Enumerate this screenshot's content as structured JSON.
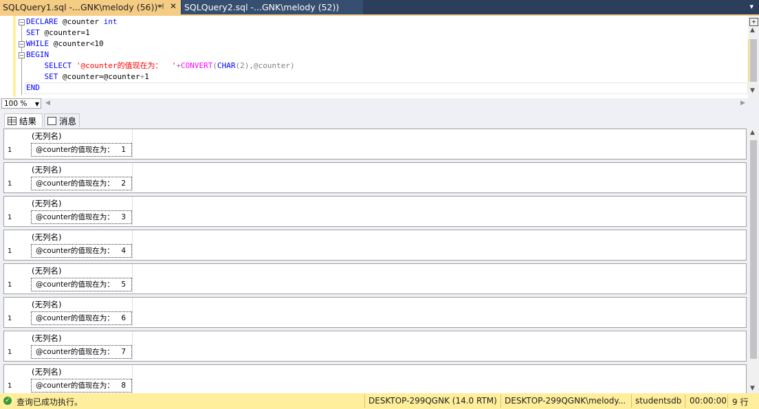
{
  "tabs": [
    {
      "title": "SQLQuery1.sql -...GNK\\melody (56))*",
      "pin": "⊣",
      "close": "✕"
    },
    {
      "title": "SQLQuery2.sql -...GNK\\melody (52))"
    }
  ],
  "editor": {
    "lines": [
      {
        "segments": [
          {
            "t": "DECLARE",
            "c": "kw"
          },
          {
            "t": " @counter ",
            "c": ""
          },
          {
            "t": "int",
            "c": "kw"
          }
        ]
      },
      {
        "segments": [
          {
            "t": "SET",
            "c": "kw"
          },
          {
            "t": " @counter=1",
            "c": ""
          }
        ]
      },
      {
        "segments": [
          {
            "t": "WHILE",
            "c": "kw"
          },
          {
            "t": " @counter<10",
            "c": ""
          }
        ]
      },
      {
        "segments": [
          {
            "t": "BEGIN",
            "c": "kw"
          }
        ]
      },
      {
        "segments": [
          {
            "t": "    ",
            "c": ""
          },
          {
            "t": "SELECT",
            "c": "kw"
          },
          {
            "t": " '@counter的值现在为：  '",
            "c": "str"
          },
          {
            "t": "+",
            "c": "gray"
          },
          {
            "t": "CONVERT",
            "c": "fn"
          },
          {
            "t": "(",
            "c": "gray"
          },
          {
            "t": "CHAR",
            "c": "kw"
          },
          {
            "t": "(2),@counter",
            "c": "gray"
          },
          {
            "t": ")",
            "c": "gray"
          }
        ]
      },
      {
        "segments": [
          {
            "t": "    ",
            "c": ""
          },
          {
            "t": "SET",
            "c": "kw"
          },
          {
            "t": " @counter=@counter",
            "c": ""
          },
          {
            "t": "+",
            "c": "gray"
          },
          {
            "t": "1",
            "c": ""
          }
        ]
      },
      {
        "segments": [
          {
            "t": "END",
            "c": "kw"
          }
        ]
      }
    ]
  },
  "zoom": {
    "value": "100 %"
  },
  "result_tabs": [
    {
      "label": "结果",
      "icon": "grid-icon"
    },
    {
      "label": "消息",
      "icon": "message-icon"
    }
  ],
  "results": [
    {
      "header": "(无列名)",
      "row": "1",
      "text": "@counter的值现在为：",
      "value": "1"
    },
    {
      "header": "(无列名)",
      "row": "1",
      "text": "@counter的值现在为：",
      "value": "2"
    },
    {
      "header": "(无列名)",
      "row": "1",
      "text": "@counter的值现在为：",
      "value": "3"
    },
    {
      "header": "(无列名)",
      "row": "1",
      "text": "@counter的值现在为：",
      "value": "4"
    },
    {
      "header": "(无列名)",
      "row": "1",
      "text": "@counter的值现在为：",
      "value": "5"
    },
    {
      "header": "(无列名)",
      "row": "1",
      "text": "@counter的值现在为：",
      "value": "6"
    },
    {
      "header": "(无列名)",
      "row": "1",
      "text": "@counter的值现在为：",
      "value": "7"
    },
    {
      "header": "(无列名)",
      "row": "1",
      "text": "@counter的值现在为：",
      "value": "8"
    }
  ],
  "status": {
    "message": "查询已成功执行。",
    "server": "DESKTOP-299QGNK (14.0 RTM)",
    "user": "DESKTOP-299QGNK\\melody...",
    "database": "studentsdb",
    "time": "00:00:00",
    "rows": "9 行"
  }
}
